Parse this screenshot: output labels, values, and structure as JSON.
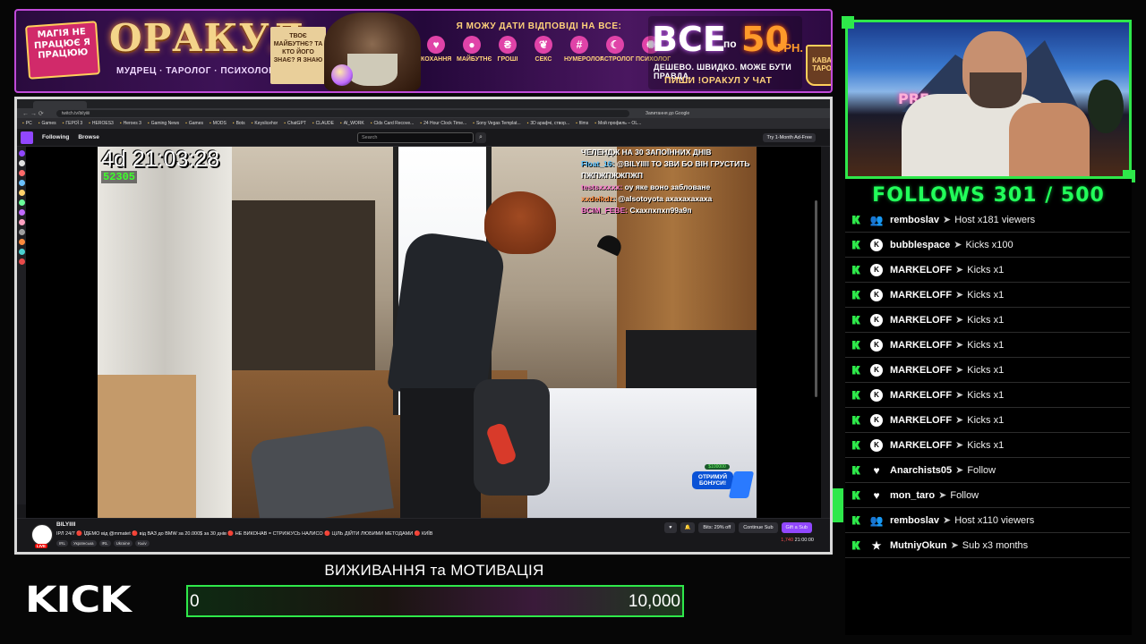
{
  "banner": {
    "magic_text": "МАГІЯ НЕ ПРАЦЮЄ Я ПРАЦЮЮ",
    "title": "ОРАКУЛ",
    "subtitle": "МУДРЕЦ · ТАРОЛОГ · ПСИХОЛОГ",
    "scroll_text": "ТВОЄ МАЙБУТНЄ? ТА КТО ЙОГО ЗНАЄ? Я ЗНАЮ",
    "answer_text": "Я МОЖУ ДАТИ ВІДПОВІДІ НА ВСЕ:",
    "categories": [
      {
        "label": "КОХАННЯ",
        "icon": "heart-icon",
        "glyph": "♥"
      },
      {
        "label": "МАЙБУТНЄ",
        "icon": "crystal-ball-icon",
        "glyph": "●"
      },
      {
        "label": "ГРОШІ",
        "icon": "money-icon",
        "glyph": "₴"
      },
      {
        "label": "СЕКС",
        "icon": "apple-icon",
        "glyph": "❦"
      },
      {
        "label": "НУМЕРОЛОГ",
        "icon": "numbers-icon",
        "glyph": "#"
      },
      {
        "label": "АСТРОЛОГ",
        "icon": "moon-icon",
        "glyph": "☾"
      },
      {
        "label": "ПСИХОЛОГ",
        "icon": "brain-icon",
        "glyph": "✺"
      }
    ],
    "price_vse": "ВСЕ",
    "price_po": "по",
    "price_amount": "50",
    "price_currency": "ГРН.",
    "price_cheap": "ДЕШЕВО. ШВИДКО. МОЖЕ БУТИ ПРАВДА.",
    "price_write": "ПИШИ !ОРАКУЛ У ЧАТ",
    "coffee_text": "КАВА ТАРО"
  },
  "browser": {
    "url": "twitch.tv/bilyiiii",
    "translate_label": "Запитання до Google",
    "bookmarks": [
      "PC",
      "Games",
      "ГЕРОЇ 3",
      "HEROES3",
      "Heroes 3",
      "Gaming News",
      "Games",
      "MODS",
      "Bots",
      "Keyslicehor",
      "ChatGPT",
      "CLAUDE",
      "AI_WORK",
      "Clds Card Recove...",
      "24 Hour Clock Time...",
      "Sony Vegas Templat...",
      "3D арафчi, створ...",
      "films",
      "Мой профиль – OL..."
    ]
  },
  "twitch": {
    "nav_following": "Following",
    "nav_browse": "Browse",
    "search_placeholder": "Search",
    "try_label": "Try 1-Month Ad-Free",
    "stream_timer": "4d 21:03:28",
    "stream_counter": "52305",
    "chat_lines": [
      {
        "user": "",
        "text": "ЧЕЛЕНДЖ НА 30 ЗАПОЇННИХ ДНІВ"
      },
      {
        "user": "Float_16:",
        "text": "@BILYIIII ТО ЗВИ БО ВІН ГРУСТИТЬ ПЖПЖПЖЖПЖП"
      },
      {
        "user": "testsxxxxx:",
        "text": "оу яке воно забловане"
      },
      {
        "user": "xxdeikdz:",
        "text": "@alsotoyota ахахахахаха"
      },
      {
        "user": "BCIM_FEBE:",
        "text": "Схахпхпхп99а9п"
      }
    ],
    "promo_amount": "$100000",
    "promo_button": "ОТРИМУЙ БОНУСИ!",
    "channel_name": "BILYIIII",
    "live_badge": "LIVE",
    "stream_title": "ІРЛ 24/7 🔴 ЇДЕМО від @mmatet 🔴 від ВАЗ до BMW за 20.000$ за 30 днів 🔴 НЕ ВИКОНАВ = СТРИЖУСЬ НАЛИСО 🔴 ЦІЛЬ ДІЙТИ ЛЮБИМИ МЕТОДАМИ 🔴 КИЇВ",
    "tags": [
      "IRL",
      "Українська",
      "IRL",
      "Ukraine",
      "Kыiv"
    ],
    "bits_label": "Bits: 29% off",
    "continue_sub": "Continue Sub",
    "gift_sub": "Gift a Sub",
    "viewers": "1,740",
    "uptime": "21:00:00"
  },
  "follows": {
    "title": "FOLLOWS 301 / 500",
    "events": [
      {
        "icon": "host-icon",
        "glyph": "👥",
        "user": "remboslav",
        "desc": "Host x181 viewers"
      },
      {
        "icon": "kick-icon",
        "glyph": "K",
        "user": "bubblespace",
        "desc": "Kicks x100"
      },
      {
        "icon": "kick-icon",
        "glyph": "K",
        "user": "MARKELOFF",
        "desc": "Kicks x1"
      },
      {
        "icon": "kick-icon",
        "glyph": "K",
        "user": "MARKELOFF",
        "desc": "Kicks x1"
      },
      {
        "icon": "kick-icon",
        "glyph": "K",
        "user": "MARKELOFF",
        "desc": "Kicks x1"
      },
      {
        "icon": "kick-icon",
        "glyph": "K",
        "user": "MARKELOFF",
        "desc": "Kicks x1"
      },
      {
        "icon": "kick-icon",
        "glyph": "K",
        "user": "MARKELOFF",
        "desc": "Kicks x1"
      },
      {
        "icon": "kick-icon",
        "glyph": "K",
        "user": "MARKELOFF",
        "desc": "Kicks x1"
      },
      {
        "icon": "kick-icon",
        "glyph": "K",
        "user": "MARKELOFF",
        "desc": "Kicks x1"
      },
      {
        "icon": "kick-icon",
        "glyph": "K",
        "user": "MARKELOFF",
        "desc": "Kicks x1"
      },
      {
        "icon": "heart-icon",
        "glyph": "♥",
        "user": "Anarchists05",
        "desc": "Follow"
      },
      {
        "icon": "heart-icon",
        "glyph": "♥",
        "user": "mon_taro",
        "desc": "Follow"
      },
      {
        "icon": "host-icon",
        "glyph": "👥",
        "user": "remboslav",
        "desc": "Host x110 viewers"
      },
      {
        "icon": "star-icon",
        "glyph": "★",
        "user": "MutniyOkun",
        "desc": "Sub x3 months"
      }
    ]
  },
  "goal": {
    "title": "ВИЖИВАННЯ та МОТИВАЦІЯ",
    "min_label": "0",
    "max_label": "10,000",
    "progress": 0
  },
  "brand": {
    "kick_logo": "KICK",
    "accent": "#2ee84a"
  }
}
